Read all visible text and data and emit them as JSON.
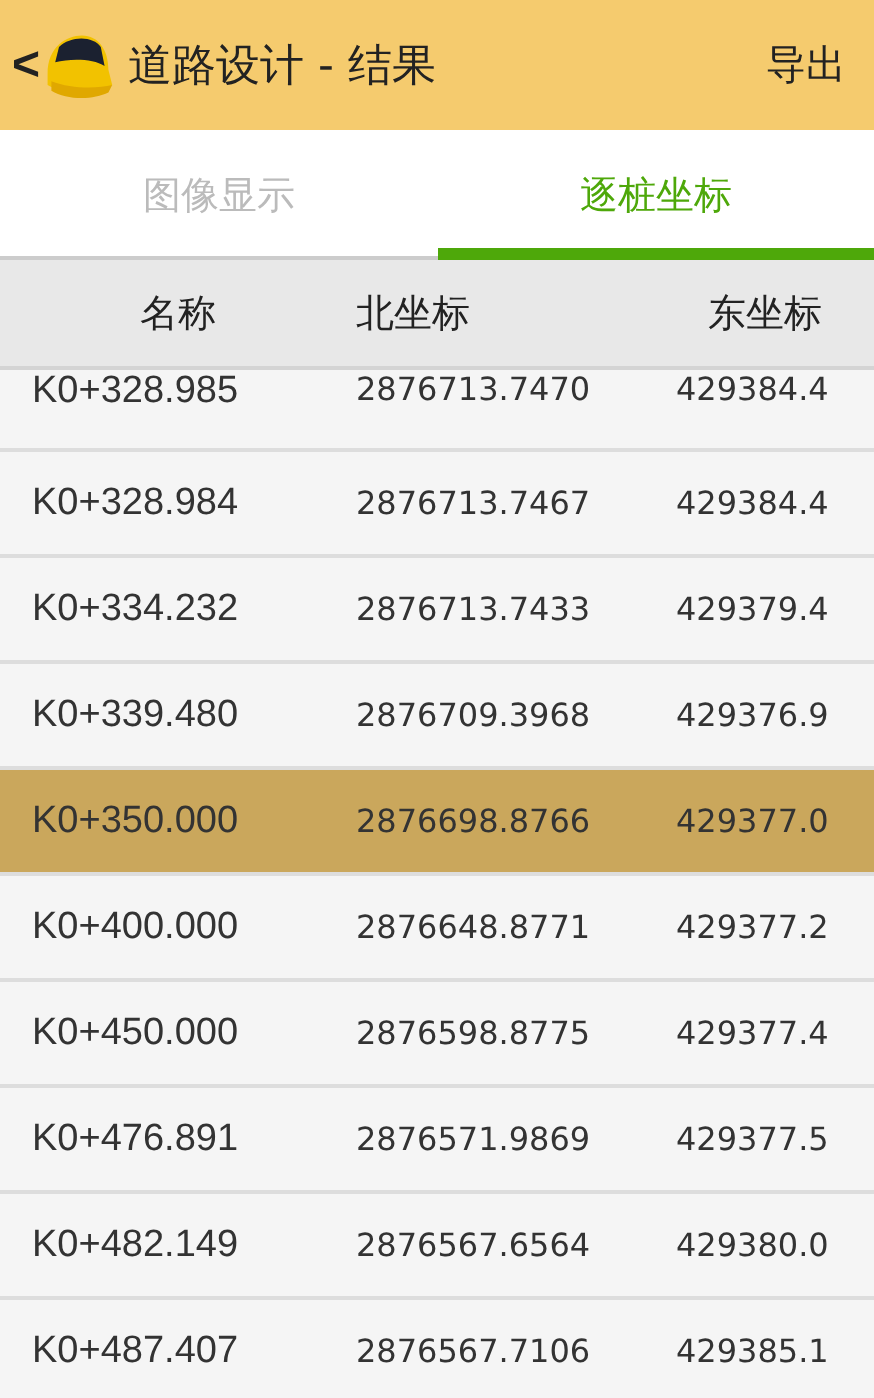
{
  "app_bar": {
    "back": "<",
    "title": "道路设计 - 结果",
    "action": "导出"
  },
  "tabs": [
    {
      "label": "图像显示",
      "selected": false
    },
    {
      "label": "逐桩坐标",
      "selected": true
    }
  ],
  "table": {
    "columns": [
      "名称",
      "北坐标",
      "东坐标"
    ],
    "rows": [
      {
        "name": "K0+328.985",
        "north": "2876713.7470",
        "east": "429384.4",
        "selected": false
      },
      {
        "name": "K0+328.984",
        "north": "2876713.7467",
        "east": "429384.4",
        "selected": false
      },
      {
        "name": "K0+334.232",
        "north": "2876713.7433",
        "east": "429379.4",
        "selected": false
      },
      {
        "name": "K0+339.480",
        "north": "2876709.3968",
        "east": "429376.9",
        "selected": false
      },
      {
        "name": "K0+350.000",
        "north": "2876698.8766",
        "east": "429377.0",
        "selected": true
      },
      {
        "name": "K0+400.000",
        "north": "2876648.8771",
        "east": "429377.2",
        "selected": false
      },
      {
        "name": "K0+450.000",
        "north": "2876598.8775",
        "east": "429377.4",
        "selected": false
      },
      {
        "name": "K0+476.891",
        "north": "2876571.9869",
        "east": "429377.5",
        "selected": false
      },
      {
        "name": "K0+482.149",
        "north": "2876567.6564",
        "east": "429380.0",
        "selected": false
      },
      {
        "name": "K0+487.407",
        "north": "2876567.7106",
        "east": "429385.1",
        "selected": false
      }
    ]
  }
}
